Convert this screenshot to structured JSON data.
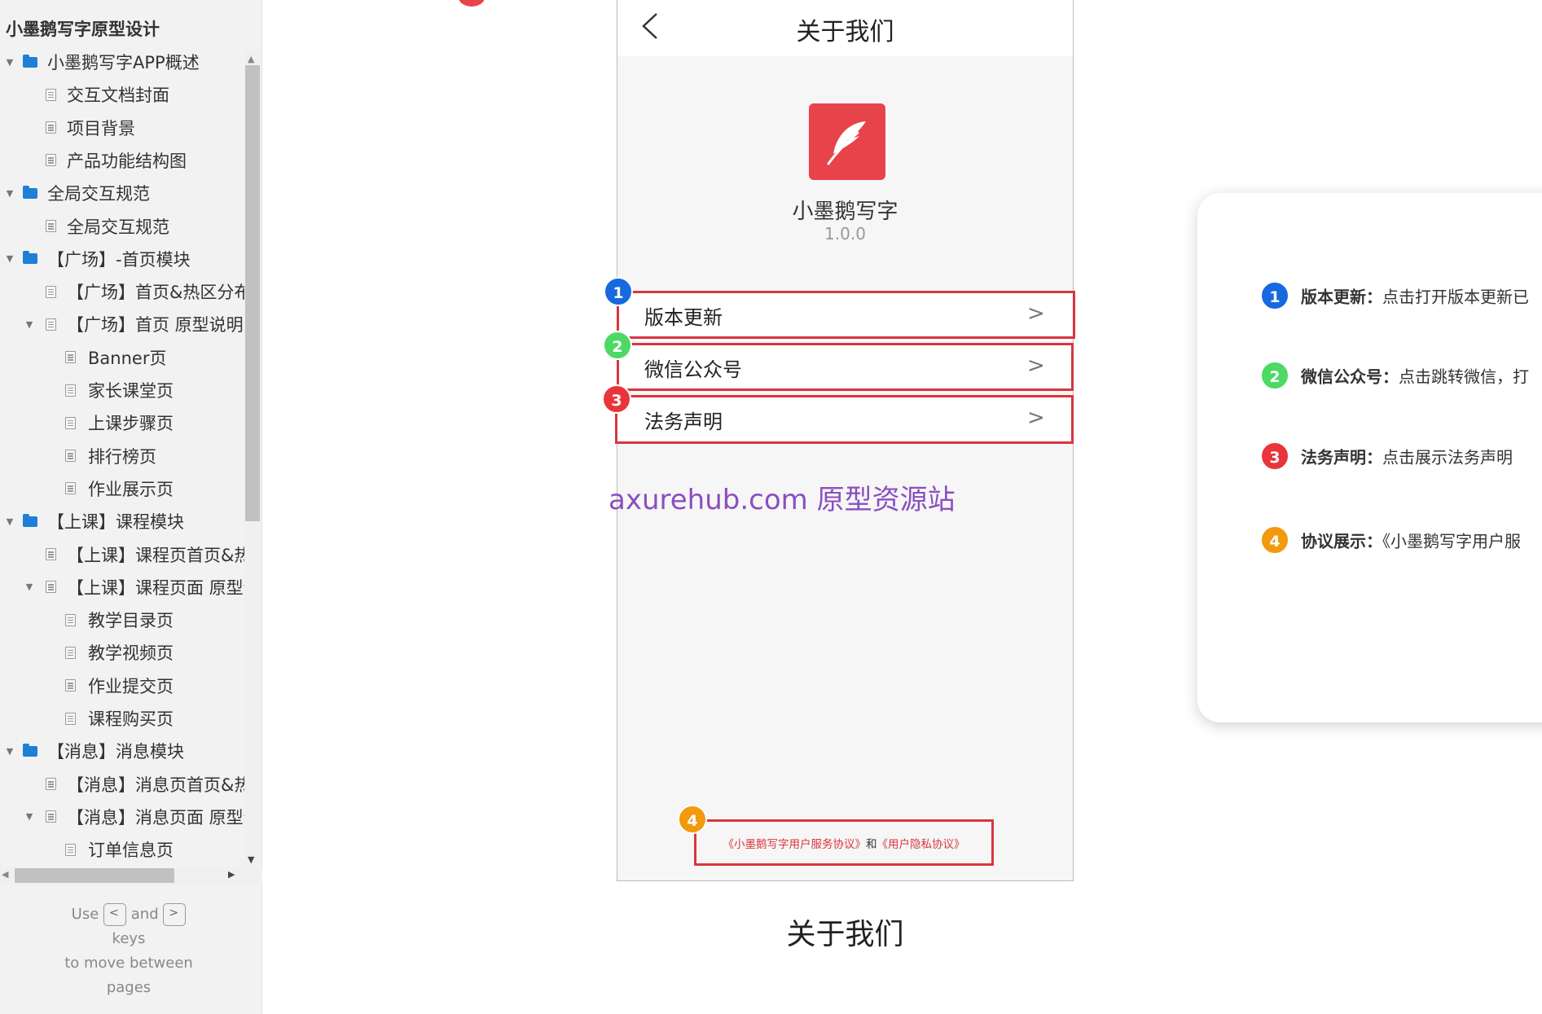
{
  "sidebar": {
    "title": "小墨鹅写字原型设计",
    "items": [
      {
        "label": "小墨鹅写字APP概述",
        "type": "folder"
      },
      {
        "label": "交互文档封面",
        "type": "page"
      },
      {
        "label": "项目背景",
        "type": "page"
      },
      {
        "label": "产品功能结构图",
        "type": "page"
      },
      {
        "label": "全局交互规范",
        "type": "folder"
      },
      {
        "label": "全局交互规范",
        "type": "page"
      },
      {
        "label": "【广场】-首页模块",
        "type": "folder"
      },
      {
        "label": "【广场】首页&热区分布",
        "type": "page"
      },
      {
        "label": "【广场】首页 原型说明",
        "type": "page"
      },
      {
        "label": "Banner页",
        "type": "page"
      },
      {
        "label": "家长课堂页",
        "type": "page"
      },
      {
        "label": "上课步骤页",
        "type": "page"
      },
      {
        "label": "排行榜页",
        "type": "page"
      },
      {
        "label": "作业展示页",
        "type": "page"
      },
      {
        "label": "【上课】课程模块",
        "type": "folder"
      },
      {
        "label": "【上课】课程页首页&热区",
        "type": "page"
      },
      {
        "label": "【上课】课程页面 原型说明",
        "type": "page"
      },
      {
        "label": "教学目录页",
        "type": "page"
      },
      {
        "label": "教学视频页",
        "type": "page"
      },
      {
        "label": "作业提交页",
        "type": "page"
      },
      {
        "label": "课程购买页",
        "type": "page"
      },
      {
        "label": "【消息】消息模块",
        "type": "folder"
      },
      {
        "label": "【消息】消息页首页&热区",
        "type": "page"
      },
      {
        "label": "【消息】消息页面 原型说明",
        "type": "page"
      },
      {
        "label": "订单信息页",
        "type": "page"
      }
    ],
    "hint": {
      "use": "Use",
      "key_prev": "<",
      "and": "and",
      "key_next": ">",
      "keys": "keys",
      "move": "to move between",
      "pages": "pages"
    }
  },
  "phone": {
    "title": "关于我们",
    "app_name": "小墨鹅写字",
    "app_version": "1.0.0",
    "menu": [
      {
        "label": "版本更新",
        "badge": "1"
      },
      {
        "label": "微信公众号",
        "badge": "2"
      },
      {
        "label": "法务声明",
        "badge": "3"
      }
    ],
    "chevron": ">",
    "agreement": {
      "badge": "4",
      "service": "《小墨鹅写字用户服务协议》",
      "and": "和",
      "privacy": "《用户隐私协议》"
    }
  },
  "watermark": "axurehub.com 原型资源站",
  "page_caption": "关于我们",
  "notes": [
    {
      "badge": "1",
      "title": "版本更新：",
      "desc": "点击打开版本更新已"
    },
    {
      "badge": "2",
      "title": "微信公众号：",
      "desc": "点击跳转微信，打"
    },
    {
      "badge": "3",
      "title": "法务声明：",
      "desc": "点击展示法务声明"
    },
    {
      "badge": "4",
      "title": "协议展示：",
      "desc": "《小墨鹅写字用户服"
    }
  ],
  "colors": {
    "accent_red": "#e8434b",
    "frame_red": "#d9363e",
    "badge_blue": "#1769e0",
    "badge_green": "#4cd964",
    "badge_red": "#e8353b",
    "badge_orange": "#f2990c",
    "folder_blue": "#1f7fd6",
    "watermark_purple": "#8a4fc0"
  },
  "icons": {
    "back": "chevron-left-icon",
    "logo": "feather-icon",
    "folder": "folder-icon",
    "page": "page-icon"
  }
}
